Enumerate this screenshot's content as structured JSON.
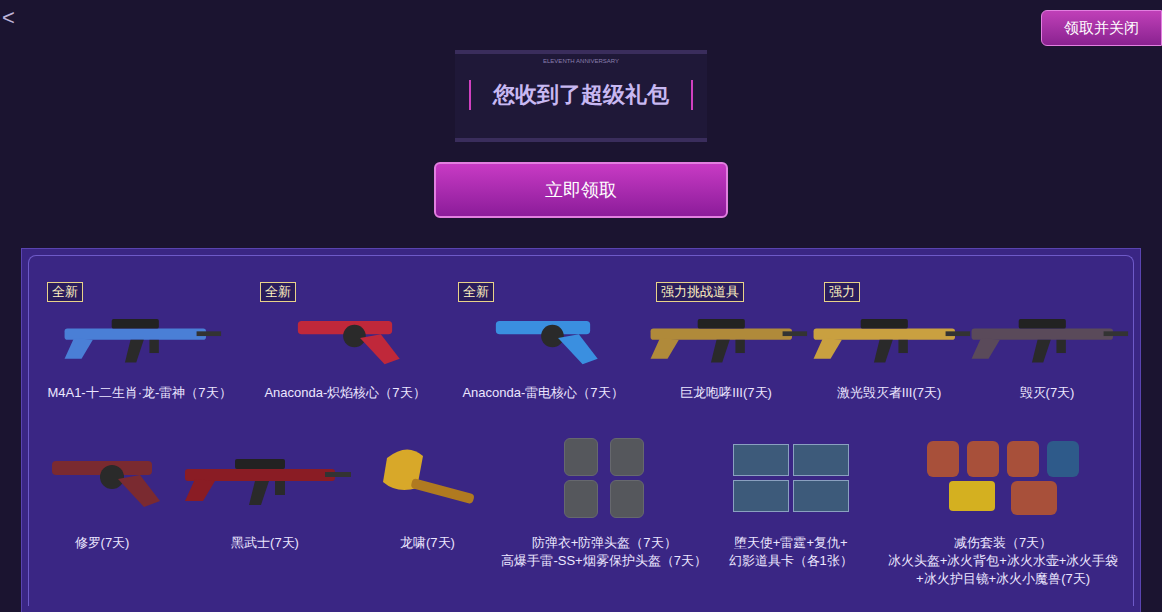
{
  "back": {
    "label": "<"
  },
  "close_button": {
    "label": "领取并关闭"
  },
  "banner": {
    "subtitle": "ELEVENTH ANNIVERSARY",
    "title": "您收到了超级礼包"
  },
  "claim_button": {
    "label": "立即领取"
  },
  "rows": [
    [
      {
        "badge": "全新",
        "kind": "rifle",
        "color": "#4a7fd6",
        "label": [
          "M4A1-十二生肖·龙-雷神（7天）"
        ]
      },
      {
        "badge": "全新",
        "kind": "pistol",
        "color": "#c0283a",
        "label": [
          "Anaconda-炽焰核心（7天）"
        ]
      },
      {
        "badge": "全新",
        "kind": "pistol",
        "color": "#3a8fe0",
        "label": [
          "Anaconda-雷电核心（7天）"
        ]
      },
      {
        "badge": "强力挑战道具",
        "kind": "rifle",
        "color": "#b08a3a",
        "label": [
          "巨龙咆哮III(7天)"
        ]
      },
      {
        "badge": "强力",
        "kind": "rifle",
        "color": "#c9a040",
        "label": [
          "激光毁灭者III(7天)"
        ]
      },
      {
        "badge": "",
        "kind": "rifle",
        "color": "#5a4a5a",
        "label": [
          "毁灭(7天)"
        ]
      }
    ],
    [
      {
        "badge": "",
        "kind": "pistol",
        "color": "#7a2a30",
        "label": [
          "修罗(7天)"
        ]
      },
      {
        "badge": "",
        "kind": "rifle",
        "color": "#8a1c24",
        "label": [
          "黑武士(7天)"
        ]
      },
      {
        "badge": "",
        "kind": "axe",
        "color": "#d8a829",
        "label": [
          "龙啸(7天)"
        ]
      },
      {
        "badge": "",
        "kind": "armor",
        "color": "#55575c",
        "label": [
          "防弹衣+防弹头盔（7天）",
          "高爆手雷-SS+烟雾保护头盔（7天）"
        ]
      },
      {
        "badge": "",
        "kind": "cards",
        "color": "#3d5a7a",
        "label": [
          "堕天使+雷霆+复仇+",
          "幻影道具卡（各1张）"
        ]
      },
      {
        "badge": "",
        "kind": "suit",
        "color": "#a8503a",
        "label": [
          "减伤套装（7天）",
          "冰火头盔+冰火背包+冰火水壶+冰火手袋",
          "+冰火护目镜+冰火小魔兽(7天)"
        ]
      }
    ]
  ]
}
